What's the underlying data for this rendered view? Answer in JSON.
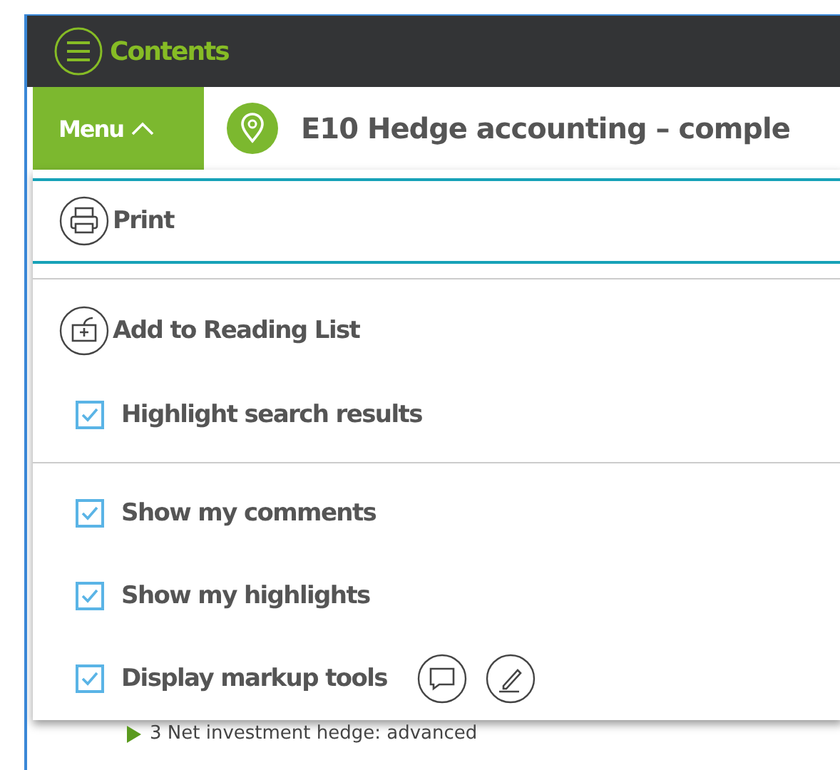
{
  "header": {
    "contents_label": "Contents"
  },
  "toolbar": {
    "menu_label": "Menu",
    "menu_expanded": true,
    "title": "E10 Hedge accounting – comple"
  },
  "menu": {
    "print": "Print",
    "add_to_reading_list": "Add to Reading List",
    "option_groups": [
      [
        {
          "label": "Highlight search results",
          "checked": true,
          "kind": "plain"
        }
      ],
      [
        {
          "label": "Show my comments",
          "checked": true,
          "kind": "plain"
        },
        {
          "label": "Show my highlights",
          "checked": true,
          "kind": "plain"
        },
        {
          "label": "Display markup tools",
          "checked": true,
          "kind": "tools"
        }
      ]
    ]
  },
  "background_item": "3 Net investment hedge: advanced"
}
